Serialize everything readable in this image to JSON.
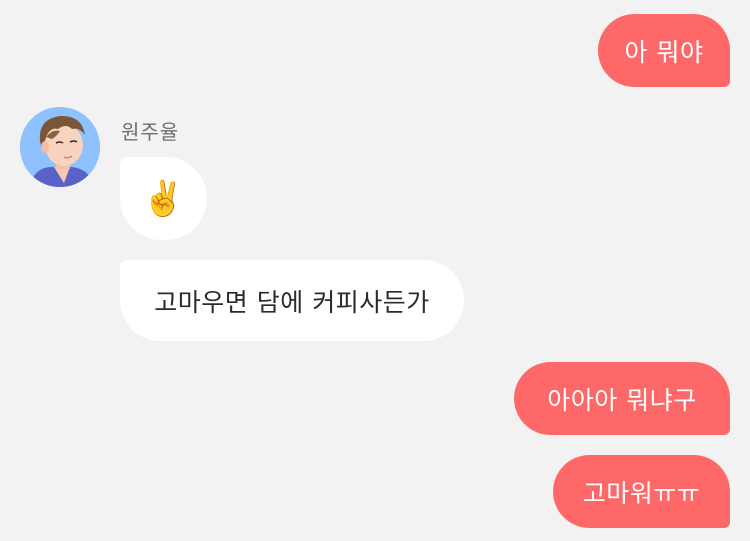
{
  "theme": {
    "background": "#f2f2f2",
    "outgoing_bubble": "#ff6868",
    "incoming_bubble": "#ffffff",
    "incoming_text": "#2b2b2b",
    "outgoing_text": "#ffffff",
    "sender_name_color": "#6f6f6f"
  },
  "contact": {
    "name": "원주율",
    "avatar_icon": "profile-avatar-illustrated-man"
  },
  "messages": [
    {
      "direction": "outgoing",
      "text": "아 뭐야"
    },
    {
      "direction": "incoming",
      "text": "✌️"
    },
    {
      "direction": "incoming",
      "text": "고마우면 담에 커피사든가"
    },
    {
      "direction": "outgoing",
      "text": "아아아 뭐냐구"
    },
    {
      "direction": "outgoing",
      "text": "고마워ㅠㅠ"
    }
  ]
}
